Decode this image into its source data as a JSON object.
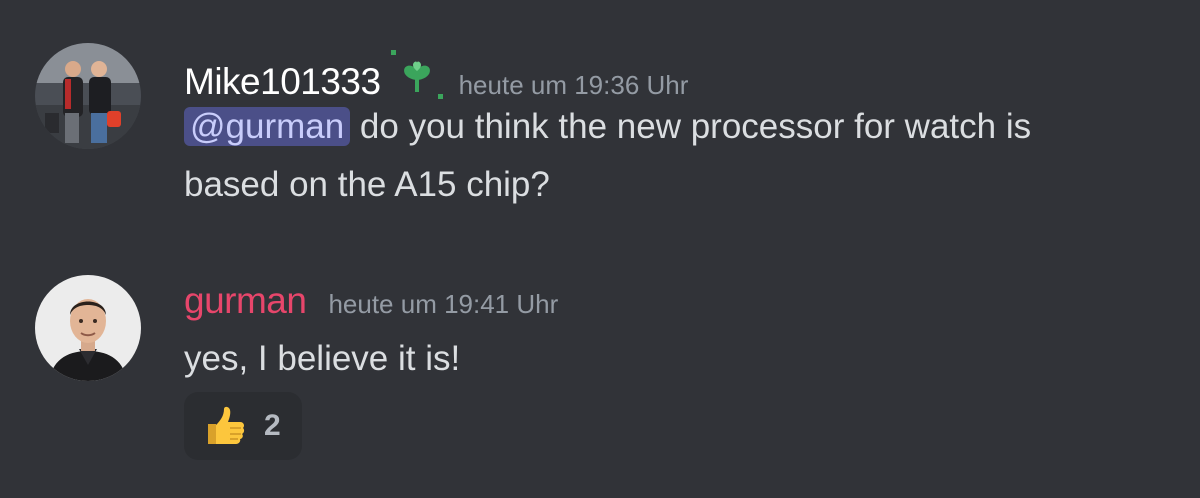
{
  "messages": [
    {
      "author": "Mike101333",
      "author_color": "#ffffff",
      "badge_icon": "sprout-icon",
      "timestamp": "heute um 19:36 Uhr",
      "mention": "@gurman",
      "text_line1": " do you think the new processor for watch  is",
      "text_line2": "based on the A15 chip?"
    },
    {
      "author": "gurman",
      "author_color": "#e7466b",
      "timestamp": "heute um 19:41 Uhr",
      "text": "yes, I believe it is!",
      "reactions": [
        {
          "emoji": "thumbs-up-icon",
          "count": "2"
        }
      ]
    }
  ],
  "colors": {
    "background": "#313338",
    "mention_bg": "#4b4f88",
    "badge_green": "#3ba55c"
  }
}
